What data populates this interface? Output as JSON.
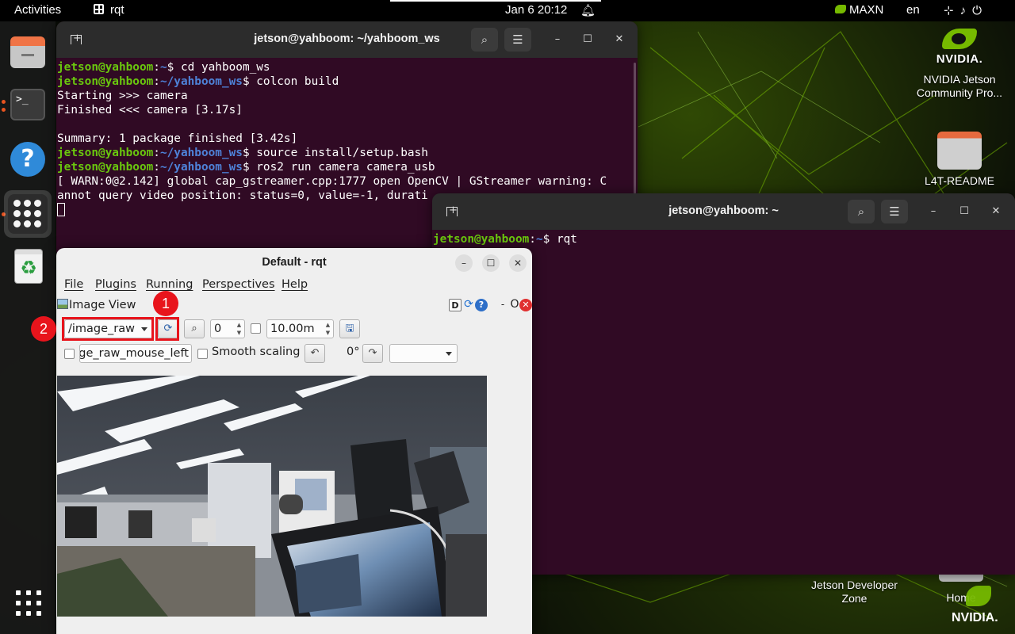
{
  "topbar": {
    "activities": "Activities",
    "app_name": "rqt",
    "clock": "Jan 6  20:12",
    "power_mode": "MAXN",
    "language": "en"
  },
  "dock": {
    "items": [
      {
        "name": "files-app",
        "icon": "files-icon"
      },
      {
        "name": "terminal-app",
        "icon": "terminal-icon",
        "glyph": ">_"
      },
      {
        "name": "help-app",
        "icon": "help-icon",
        "glyph": "?"
      },
      {
        "name": "app-grid",
        "icon": "apps-icon"
      },
      {
        "name": "trash-app",
        "icon": "trash-icon",
        "glyph": "♻"
      }
    ]
  },
  "desktop_icons": {
    "nvidia_brand": "NVIDIA.",
    "jetson_community": "NVIDIA Jetson\nCommunity Pro...",
    "l4t_readme": "L4T-README",
    "jetson_dev_zone": "Jetson Developer\nZone",
    "home": "Home",
    "corner_brand": "NVIDIA."
  },
  "terminal1": {
    "title": "jetson@yahboom: ~/yahboom_ws",
    "lines": [
      {
        "user": "jetson@yahboom",
        "path": "~",
        "cmd": "$ cd yahboom_ws"
      },
      {
        "user": "jetson@yahboom",
        "path": "~/yahboom_ws",
        "cmd": "$ colcon build"
      },
      {
        "text": "Starting >>> camera"
      },
      {
        "text": "Finished <<< camera [3.17s]"
      },
      {
        "text": ""
      },
      {
        "text": "Summary: 1 package finished [3.42s]"
      },
      {
        "user": "jetson@yahboom",
        "path": "~/yahboom_ws",
        "cmd": "$ source install/setup.bash"
      },
      {
        "user": "jetson@yahboom",
        "path": "~/yahboom_ws",
        "cmd": "$ ros2 run camera camera_usb"
      },
      {
        "text": "[ WARN:0@2.142] global cap_gstreamer.cpp:1777 open OpenCV | GStreamer warning: C"
      },
      {
        "text": "annot query video position: status=0, value=-1, durati"
      }
    ]
  },
  "terminal2": {
    "title": "jetson@yahboom: ~",
    "user": "jetson@yahboom",
    "path": "~",
    "cmd": "$ rqt"
  },
  "rqt": {
    "title": "Default - rqt",
    "menu": [
      "File",
      "Plugins",
      "Running",
      "Perspectives",
      "Help"
    ],
    "plugin_title": "Image View",
    "dock_d": "D",
    "dock_min": "-",
    "dock_float": "O",
    "topic": "/image_raw",
    "spin_value": "0",
    "rate_value": "10.00m",
    "mouse_topic": "/image_raw_mouse_left",
    "smooth_label": "Smooth scaling",
    "rotation": "0°",
    "rotation_combo": ""
  },
  "annotations": {
    "badge1": "1",
    "badge2": "2",
    "color": "#e8141c"
  }
}
